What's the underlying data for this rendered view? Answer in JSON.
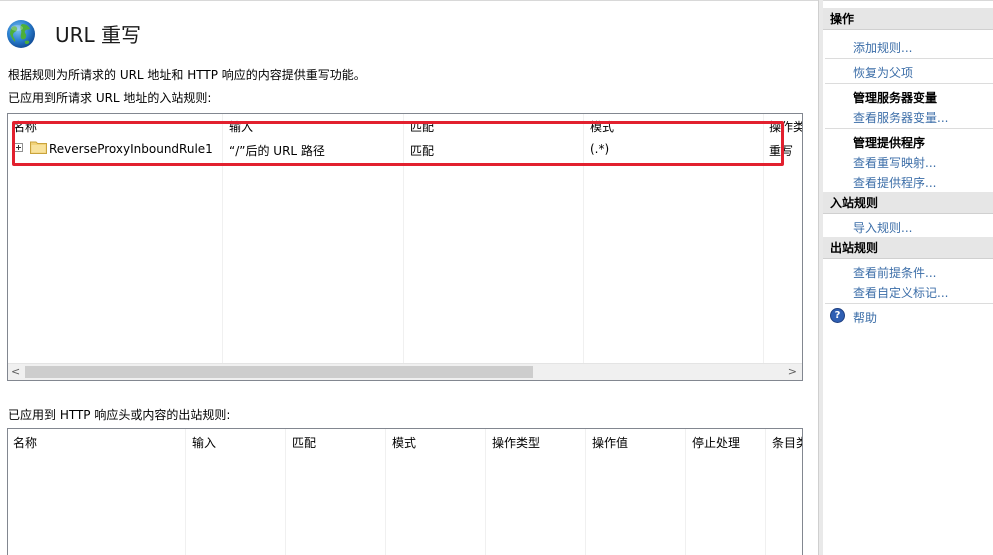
{
  "page": {
    "title": "URL 重写",
    "description": "根据规则为所请求的 URL 地址和 HTTP 响应的内容提供重写功能。",
    "inbound_label": "已应用到所请求 URL 地址的入站规则:",
    "outbound_label": "已应用到 HTTP 响应头或内容的出站规则:"
  },
  "inbound": {
    "columns": [
      "名称",
      "输入",
      "匹配",
      "模式",
      "操作类"
    ],
    "rows": [
      {
        "name": "ReverseProxyInboundRule1",
        "input": "“/”后的 URL 路径",
        "match": "匹配",
        "pattern": "(.*)",
        "action": "重写"
      }
    ],
    "scroll_left": "<",
    "scroll_right": ">"
  },
  "outbound": {
    "columns": [
      "名称",
      "输入",
      "匹配",
      "模式",
      "操作类型",
      "操作值",
      "停止处理",
      "条目类"
    ]
  },
  "actions": {
    "header": "操作",
    "add_rule": "添加规则...",
    "revert_parent": "恢复为父项",
    "server_vars_title": "管理服务器变量",
    "view_server_vars": "查看服务器变量...",
    "providers_title": "管理提供程序",
    "view_rewrite_maps": "查看重写映射...",
    "view_providers": "查看提供程序...",
    "inbound_header": "入站规则",
    "import_rules": "导入规则...",
    "outbound_header": "出站规则",
    "view_preconditions": "查看前提条件...",
    "view_custom_tags": "查看自定义标记...",
    "help": "帮助",
    "help_glyph": "?"
  },
  "colors": {
    "highlight": "#e2202e",
    "link": "#3c6ea8",
    "help_icon": "#2f5fb3"
  }
}
